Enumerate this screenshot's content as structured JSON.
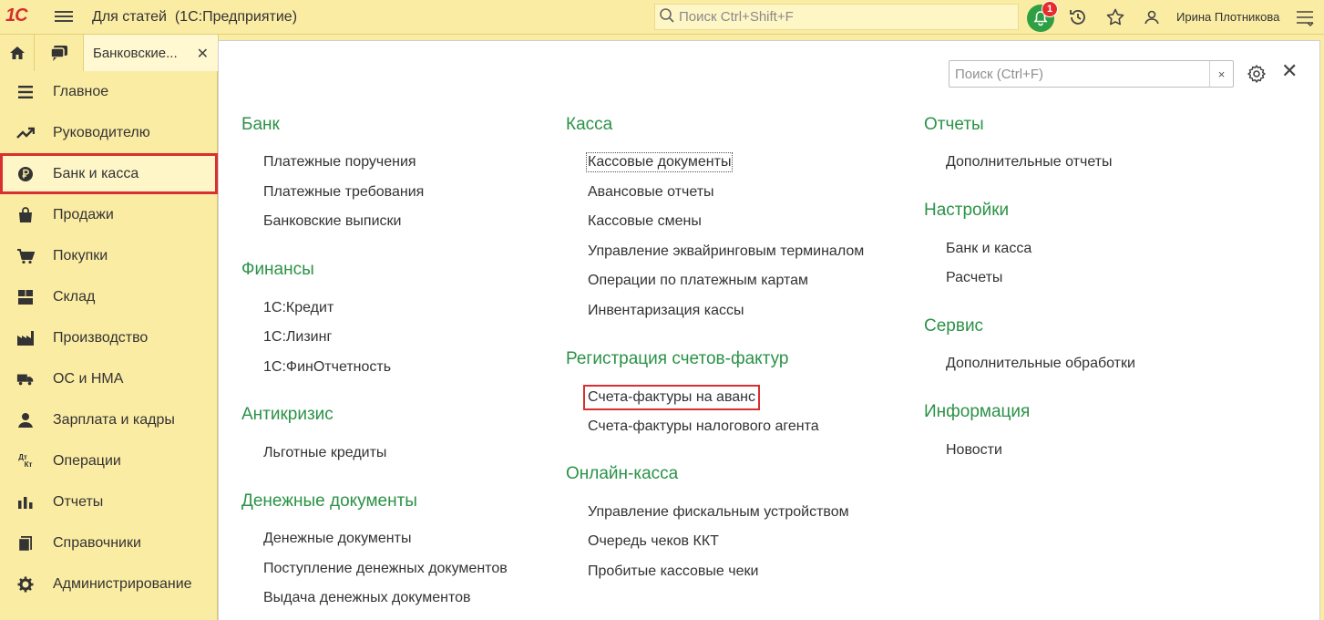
{
  "app": {
    "logo": "1С",
    "title": "Для статей  (1С:Предприятие)",
    "search_placeholder": "Поиск Ctrl+Shift+F",
    "notifications_count": "1",
    "user_name": "Ирина Плотникова"
  },
  "tabs": {
    "open_tab": "Банковские..."
  },
  "sidebar": {
    "items": [
      {
        "label": "Главное",
        "icon": "menu-lines-icon"
      },
      {
        "label": "Руководителю",
        "icon": "trend-icon"
      },
      {
        "label": "Банк и касса",
        "icon": "ruble-coin-icon"
      },
      {
        "label": "Продажи",
        "icon": "shopping-bag-icon"
      },
      {
        "label": "Покупки",
        "icon": "cart-icon"
      },
      {
        "label": "Склад",
        "icon": "warehouse-icon"
      },
      {
        "label": "Производство",
        "icon": "factory-icon"
      },
      {
        "label": "ОС и НМА",
        "icon": "truck-icon"
      },
      {
        "label": "Зарплата и кадры",
        "icon": "person-icon"
      },
      {
        "label": "Операции",
        "icon": "dt-kt-icon"
      },
      {
        "label": "Отчеты",
        "icon": "bar-chart-icon"
      },
      {
        "label": "Справочники",
        "icon": "books-icon"
      },
      {
        "label": "Администрирование",
        "icon": "gear-icon"
      }
    ],
    "icon_dt": "Дт",
    "icon_kt": "Кт"
  },
  "panel": {
    "search_placeholder": "Поиск (Ctrl+F)",
    "clear_symbol": "×",
    "close_symbol": "✕",
    "sections": {
      "bank": {
        "title": "Банк",
        "links": [
          "Платежные поручения",
          "Платежные требования",
          "Банковские выписки"
        ]
      },
      "finance": {
        "title": "Финансы",
        "links": [
          "1С:Кредит",
          "1С:Лизинг",
          "1С:ФинОтчетность"
        ]
      },
      "anticrisis": {
        "title": "Антикризис",
        "links": [
          "Льготные кредиты"
        ]
      },
      "money_docs": {
        "title": "Денежные документы",
        "links": [
          "Денежные документы",
          "Поступление денежных документов",
          "Выдача денежных документов"
        ]
      },
      "cash": {
        "title": "Касса",
        "links": [
          "Кассовые документы",
          "Авансовые отчеты",
          "Кассовые смены",
          "Управление эквайринговым терминалом",
          "Операции по платежным картам",
          "Инвентаризация кассы"
        ]
      },
      "invoices": {
        "title": "Регистрация счетов-фактур",
        "links": [
          "Счета-фактуры на аванс",
          "Счета-фактуры налогового агента"
        ]
      },
      "online_cash": {
        "title": "Онлайн-касса",
        "links": [
          "Управление фискальным устройством",
          "Очередь чеков ККТ",
          "Пробитые кассовые чеки"
        ]
      },
      "reports": {
        "title": "Отчеты",
        "links": [
          "Дополнительные отчеты"
        ]
      },
      "settings": {
        "title": "Настройки",
        "links": [
          "Банк и касса",
          "Расчеты"
        ]
      },
      "service": {
        "title": "Сервис",
        "links": [
          "Дополнительные обработки"
        ]
      },
      "info": {
        "title": "Информация",
        "links": [
          "Новости"
        ]
      }
    }
  },
  "colors": {
    "accent_green": "#2b9247",
    "highlight_red": "#d92f2f",
    "sidebar_bg": "#fbeca3"
  }
}
